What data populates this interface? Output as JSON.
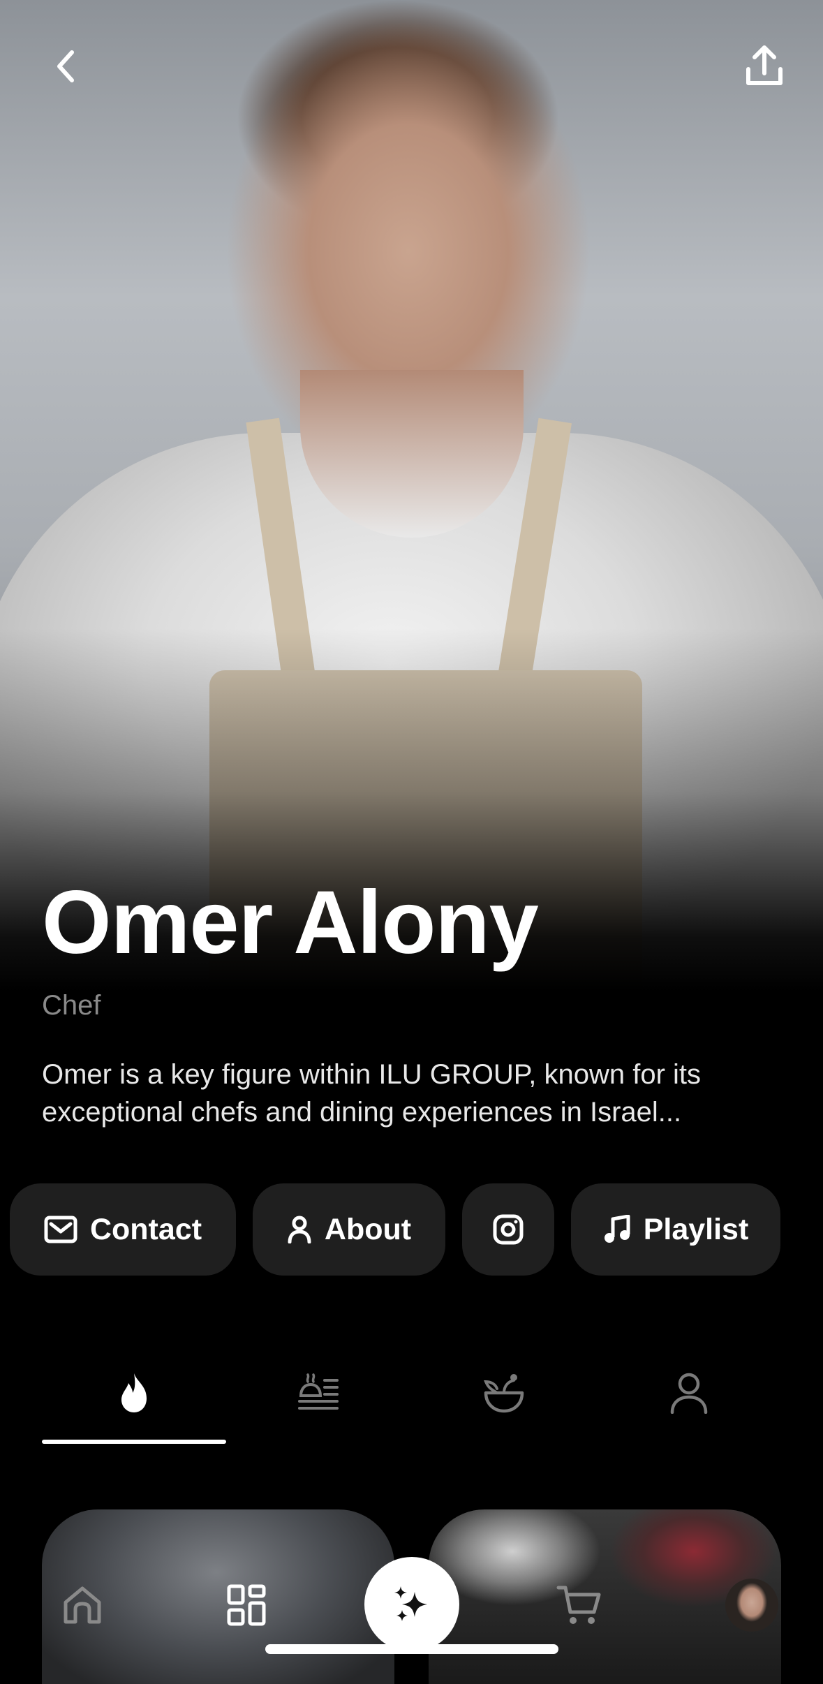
{
  "profile": {
    "name": "Omer Alony",
    "role": "Chef",
    "bio": "Omer is a key figure within ILU GROUP, known for its exceptional chefs and dining experiences in Israel..."
  },
  "header": {
    "back_icon": "chevron-left-icon",
    "share_icon": "share-upload-icon"
  },
  "actions": [
    {
      "label": "Contact",
      "icon": "mail-icon"
    },
    {
      "label": "About",
      "icon": "person-icon"
    },
    {
      "label": "",
      "icon": "instagram-icon"
    },
    {
      "label": "Playlist",
      "icon": "music-note-icon"
    }
  ],
  "tabs": [
    {
      "icon": "flame-icon",
      "active": true
    },
    {
      "icon": "dish-list-icon",
      "active": false
    },
    {
      "icon": "bowl-sprout-icon",
      "active": false
    },
    {
      "icon": "person-icon",
      "active": false
    }
  ],
  "bottom_nav": [
    {
      "icon": "home-icon"
    },
    {
      "icon": "grid-icon"
    },
    {
      "icon": "sparkle-icon"
    },
    {
      "icon": "cart-icon"
    },
    {
      "icon": "avatar"
    }
  ],
  "colors": {
    "background": "#000000",
    "pill": "#1f1f1f",
    "muted_text": "#8a8a8a",
    "accent": "#ffffff"
  }
}
